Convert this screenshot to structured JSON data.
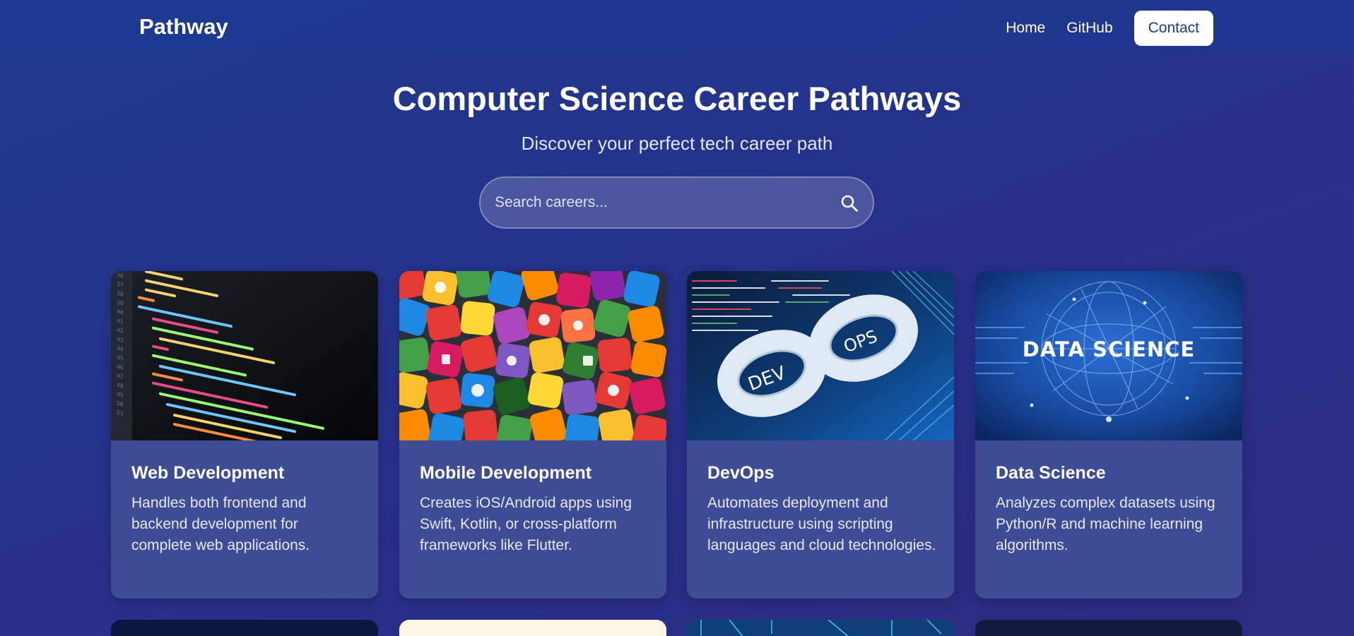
{
  "nav": {
    "brand": "Pathway",
    "links": [
      "Home",
      "GitHub"
    ],
    "contact_label": "Contact"
  },
  "hero": {
    "title": "Computer Science Career Pathways",
    "subtitle": "Discover your perfect tech career path"
  },
  "search": {
    "placeholder": "Search careers...",
    "value": ""
  },
  "cards": [
    {
      "title": "Web Development",
      "description": "Handles both frontend and backend development for complete web applications."
    },
    {
      "title": "Mobile Development",
      "description": "Creates iOS/Android apps using Swift, Kotlin, or cross-platform frameworks like Flutter."
    },
    {
      "title": "DevOps",
      "description": "Automates deployment and infrastructure using scripting languages and cloud technologies."
    },
    {
      "title": "Data Science",
      "description": "Analyzes complex datasets using Python/R and machine learning algorithms."
    }
  ],
  "image_text": {
    "devops_left": "DEV",
    "devops_right": "OPS",
    "data_science": "DATA SCIENCE"
  },
  "colors": {
    "background": "#25318a",
    "card": "#3e4b95",
    "accent": "#1f3a8a"
  }
}
